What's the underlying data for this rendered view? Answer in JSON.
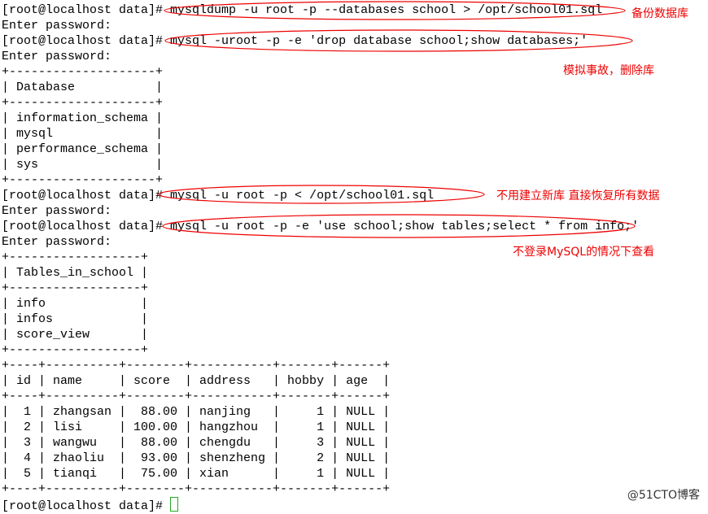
{
  "terminal": {
    "lines": [
      "[root@localhost data]# mysqldump -u root -p --databases school > /opt/school01.sql",
      "Enter password:",
      "[root@localhost data]# mysql -uroot -p -e 'drop database school;show databases;'",
      "Enter password:",
      "+--------------------+",
      "| Database           |",
      "+--------------------+",
      "| information_schema |",
      "| mysql              |",
      "| performance_schema |",
      "| sys                |",
      "+--------------------+",
      "[root@localhost data]# mysql -u root -p < /opt/school01.sql",
      "Enter password:",
      "[root@localhost data]# mysql -u root -p -e 'use school;show tables;select * from info;'",
      "Enter password:",
      "+------------------+",
      "| Tables_in_school |",
      "+------------------+",
      "| info             |",
      "| infos            |",
      "| score_view       |",
      "+------------------+",
      "+----+----------+--------+-----------+-------+------+",
      "| id | name     | score  | address   | hobby | age  |",
      "+----+----------+--------+-----------+-------+------+",
      "|  1 | zhangsan |  88.00 | nanjing   |     1 | NULL |",
      "|  2 | lisi     | 100.00 | hangzhou  |     1 | NULL |",
      "|  3 | wangwu   |  88.00 | chengdu   |     3 | NULL |",
      "|  4 | zhaoliu  |  93.00 | shenzheng |     2 | NULL |",
      "|  5 | tianqi   |  75.00 | xian      |     1 | NULL |",
      "+----+----------+--------+-----------+-------+------+"
    ],
    "prompt": "[root@localhost data]# "
  },
  "annotations": {
    "backup": "备份数据库",
    "drop": "模拟事故，删除库",
    "restore": "不用建立新库 直接恢复所有数据",
    "view": "不登录MySQL的情况下查看"
  },
  "watermark": "@51CTO博客",
  "colors": {
    "annotation": "#e00000",
    "cursor": "#22aa22"
  }
}
